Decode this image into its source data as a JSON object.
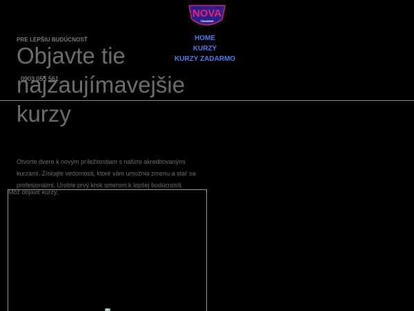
{
  "brand": {
    "logo_text": "NOVA",
    "logo_subtext": "TRAINING",
    "logo_colors": [
      "#d6206e",
      "#3a2fb8",
      "#ffffff"
    ]
  },
  "nav": {
    "items": [
      {
        "label": "HOME"
      },
      {
        "label": "KURZY"
      },
      {
        "label": "KURZY ZADARMO"
      }
    ],
    "color": "#4a7df0"
  },
  "hero": {
    "eyebrow": "PRE LEPŠIU BUDÚCNOSŤ",
    "phone": "0903 055 561",
    "headline": "Objavte tie najzaujímavejšie kurzy",
    "intro": "Otvorte dvere k novým príležitostiam s našimi akreditovanými kurzami. Získajte vedomosti, ktoré vám umožnia zmenu a stať sa profesionálmi. Urobte prvý krok smerom k lepšej budúcnosti."
  },
  "video": {
    "caption": "Môž objaviť kurzy,",
    "broken_image_icon": "broken-image-icon"
  }
}
